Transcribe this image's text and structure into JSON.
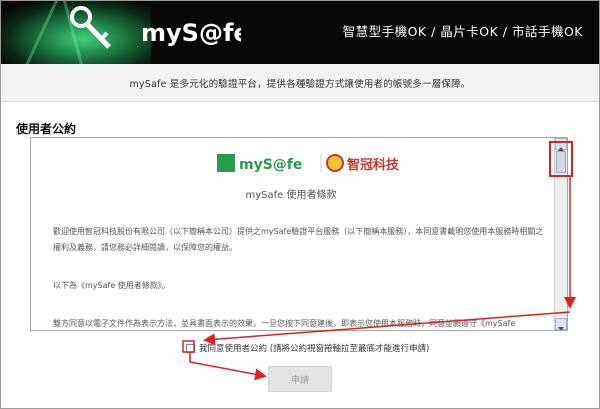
{
  "header": {
    "brand": "myS@fe",
    "tagline": "智慧型手機OK / 晶片卡OK / 市話手機OK"
  },
  "notice": "mySafe 是多元化的驗證平台，提供各種驗證方式讓使用者的帳號多一層保障。",
  "section_title": "使用者公約",
  "terms": {
    "logo_left": "myS@fe",
    "logo_right": "智冠科技",
    "title": "mySafe 使用者條款",
    "paragraphs": [
      "歡迎使用智冠科技股份有限公司（以下簡稱本公司）提供之mySafe驗證平台服務（以下簡稱本服務），本同意書載明您使用本服務時相關之權利及義務，請您務必詳細閱讀，以保障您的權益。",
      "以下為《mySafe 使用者條款》。",
      "雙方同意以電子文件作為表示方法，並具書面表示的效果，一旦您按下同意建後，即表示您使用本服務時，同意並願遵守《mySafe"
    ]
  },
  "agree": {
    "label": "我同意使用者公約 (請將公約視窗捲軸拉至最底才能進行申請)",
    "checked": false
  },
  "apply_button": "申請",
  "colors": {
    "header_bg": "#070707",
    "annotation_red": "#e02020",
    "brand_green": "#2b9a4a",
    "button_disabled": "#e2e2e2"
  }
}
